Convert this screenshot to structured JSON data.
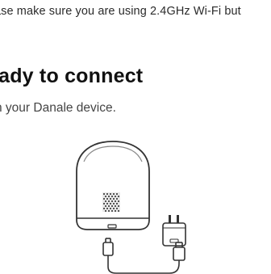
{
  "notice": {
    "text": "ase make sure you are using 2.4GHz Wi-Fi but"
  },
  "heading": {
    "text": "eady to connect"
  },
  "subtext": {
    "text": "n your Danale device."
  },
  "illustration": {
    "icons": [
      "camera-icon",
      "power-adapter-icon",
      "usb-cable-icon"
    ],
    "stroke_color": "#333333"
  }
}
